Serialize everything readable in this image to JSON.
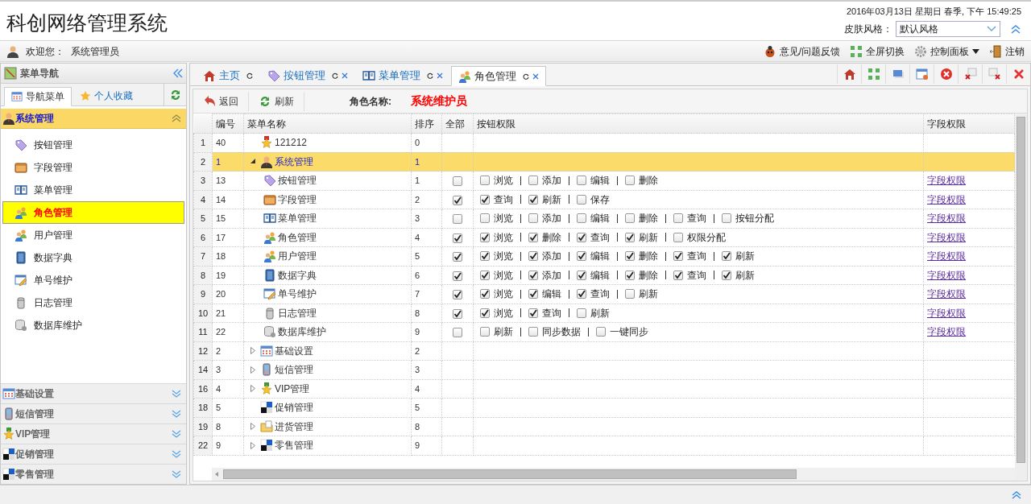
{
  "header": {
    "title": "科创网络管理系统",
    "datetime": "2016年03月13日 星期日 春季, 下午 15:49:25",
    "skin_label": "皮肤风格：",
    "skin_value": "默认风格"
  },
  "user_bar": {
    "welcome": "欢迎您：",
    "user": "系统管理员",
    "actions": [
      {
        "label": "意见/问题反馈",
        "dropdown": false
      },
      {
        "label": "全屏切换",
        "dropdown": false
      },
      {
        "label": "控制面板",
        "dropdown": true
      },
      {
        "label": "注销",
        "dropdown": false
      }
    ]
  },
  "sidebar": {
    "title": "菜单导航",
    "tabs": [
      {
        "label": "导航菜单",
        "selected": true
      },
      {
        "label": "个人收藏",
        "selected": false
      }
    ],
    "groups": [
      {
        "label": "系统管理",
        "expanded": true,
        "items": [
          {
            "label": "按钮管理",
            "selected": false
          },
          {
            "label": "字段管理",
            "selected": false
          },
          {
            "label": "菜单管理",
            "selected": false
          },
          {
            "label": "角色管理",
            "selected": true
          },
          {
            "label": "用户管理",
            "selected": false
          },
          {
            "label": "数据字典",
            "selected": false
          },
          {
            "label": "单号维护",
            "selected": false
          },
          {
            "label": "日志管理",
            "selected": false
          },
          {
            "label": "数据库维护",
            "selected": false
          }
        ]
      },
      {
        "label": "基础设置",
        "expanded": false
      },
      {
        "label": "短信管理",
        "expanded": false
      },
      {
        "label": "VIP管理",
        "expanded": false
      },
      {
        "label": "促销管理",
        "expanded": false
      },
      {
        "label": "零售管理",
        "expanded": false
      }
    ]
  },
  "tabs": [
    {
      "label": "主页",
      "closable": false,
      "selected": false
    },
    {
      "label": "按钮管理",
      "closable": true,
      "selected": false
    },
    {
      "label": "菜单管理",
      "closable": true,
      "selected": false
    },
    {
      "label": "角色管理",
      "closable": true,
      "selected": true
    }
  ],
  "toolbar": {
    "buttons": [
      "返回",
      "刷新"
    ],
    "role_label": "角色名称:",
    "role_name": "系统维护员"
  },
  "table": {
    "columns": [
      "编号",
      "菜单名称",
      "排序",
      "全部",
      "按钮权限",
      "字段权限"
    ],
    "rows": [
      {
        "row_no": "1",
        "id": "40",
        "name": "121212",
        "order": "0",
        "kind": "leaf",
        "selected": false
      },
      {
        "row_no": "2",
        "id": "1",
        "name": "系统管理",
        "order": "1",
        "kind": "group",
        "expanded": true,
        "selected": true,
        "children": [
          {
            "row_no": "3",
            "id": "13",
            "name": "按钮管理",
            "order": "1",
            "kind": "permission",
            "all": false,
            "selected": false,
            "field_link": "字段权限",
            "buttons": [
              {
                "label": "浏览",
                "checked": false
              },
              {
                "label": "添加",
                "checked": false
              },
              {
                "label": "编辑",
                "checked": false
              },
              {
                "label": "删除",
                "checked": false
              }
            ]
          },
          {
            "row_no": "4",
            "id": "14",
            "name": "字段管理",
            "order": "2",
            "kind": "permission",
            "all": true,
            "selected": false,
            "field_link": "字段权限",
            "buttons": [
              {
                "label": "查询",
                "checked": true
              },
              {
                "label": "刷新",
                "checked": true
              },
              {
                "label": "保存",
                "checked": false
              }
            ]
          },
          {
            "row_no": "5",
            "id": "15",
            "name": "菜单管理",
            "order": "3",
            "kind": "permission",
            "all": false,
            "selected": false,
            "field_link": "字段权限",
            "buttons": [
              {
                "label": "浏览",
                "checked": false
              },
              {
                "label": "添加",
                "checked": false
              },
              {
                "label": "编辑",
                "checked": false
              },
              {
                "label": "删除",
                "checked": false
              },
              {
                "label": "查询",
                "checked": false
              },
              {
                "label": "按钮分配",
                "checked": false
              }
            ]
          },
          {
            "row_no": "6",
            "id": "17",
            "name": "角色管理",
            "order": "4",
            "kind": "permission",
            "all": true,
            "selected": false,
            "field_link": "字段权限",
            "buttons": [
              {
                "label": "浏览",
                "checked": true
              },
              {
                "label": "删除",
                "checked": true
              },
              {
                "label": "查询",
                "checked": true
              },
              {
                "label": "刷新",
                "checked": true
              },
              {
                "label": "权限分配",
                "checked": false
              }
            ]
          },
          {
            "row_no": "7",
            "id": "18",
            "name": "用户管理",
            "order": "5",
            "kind": "permission",
            "all": true,
            "selected": false,
            "field_link": "字段权限",
            "buttons": [
              {
                "label": "浏览",
                "checked": true
              },
              {
                "label": "添加",
                "checked": true
              },
              {
                "label": "编辑",
                "checked": true
              },
              {
                "label": "删除",
                "checked": true
              },
              {
                "label": "查询",
                "checked": true
              },
              {
                "label": "刷新",
                "checked": true
              }
            ]
          },
          {
            "row_no": "8",
            "id": "19",
            "name": "数据字典",
            "order": "6",
            "kind": "permission",
            "all": true,
            "selected": false,
            "field_link": "字段权限",
            "buttons": [
              {
                "label": "浏览",
                "checked": true
              },
              {
                "label": "添加",
                "checked": true
              },
              {
                "label": "编辑",
                "checked": true
              },
              {
                "label": "删除",
                "checked": true
              },
              {
                "label": "查询",
                "checked": true
              },
              {
                "label": "刷新",
                "checked": true
              }
            ]
          },
          {
            "row_no": "9",
            "id": "20",
            "name": "单号维护",
            "order": "7",
            "kind": "permission",
            "all": true,
            "selected": false,
            "field_link": "字段权限",
            "buttons": [
              {
                "label": "浏览",
                "checked": true
              },
              {
                "label": "编辑",
                "checked": true
              },
              {
                "label": "查询",
                "checked": true
              },
              {
                "label": "刷新",
                "checked": false
              }
            ]
          },
          {
            "row_no": "10",
            "id": "21",
            "name": "日志管理",
            "order": "8",
            "kind": "permission",
            "all": true,
            "selected": false,
            "field_link": "字段权限",
            "buttons": [
              {
                "label": "浏览",
                "checked": true
              },
              {
                "label": "查询",
                "checked": true
              },
              {
                "label": "刷新",
                "checked": false
              }
            ]
          },
          {
            "row_no": "11",
            "id": "22",
            "name": "数据库维护",
            "order": "9",
            "kind": "permission",
            "all": false,
            "selected": false,
            "field_link": "字段权限",
            "buttons": [
              {
                "label": "刷新",
                "checked": false
              },
              {
                "label": "同步数据",
                "checked": false
              },
              {
                "label": "一键同步",
                "checked": false
              }
            ]
          }
        ]
      },
      {
        "row_no": "12",
        "id": "2",
        "name": "基础设置",
        "order": "2",
        "kind": "group",
        "expanded": false,
        "selected": false
      },
      {
        "row_no": "14",
        "id": "3",
        "name": "短信管理",
        "order": "3",
        "kind": "group",
        "expanded": false,
        "selected": false
      },
      {
        "row_no": "16",
        "id": "4",
        "name": "VIP管理",
        "order": "4",
        "kind": "group",
        "expanded": false,
        "selected": false
      },
      {
        "row_no": "18",
        "id": "5",
        "name": "促销管理",
        "order": "5",
        "kind": "leaf",
        "selected": false
      },
      {
        "row_no": "19",
        "id": "8",
        "name": "进货管理",
        "order": "8",
        "kind": "group",
        "expanded": false,
        "selected": false
      },
      {
        "row_no": "22",
        "id": "9",
        "name": "零售管理",
        "order": "9",
        "kind": "group",
        "expanded": false,
        "selected": false
      }
    ]
  }
}
